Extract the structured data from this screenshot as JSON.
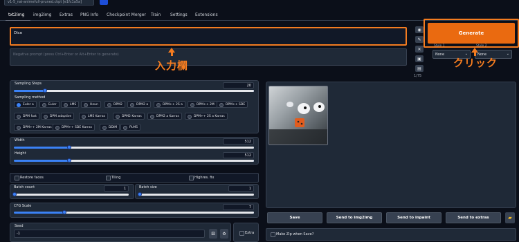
{
  "top": {
    "model_text": "v1-5_nai-animefull-pruned.ckpt [e1fc1a5a]"
  },
  "tabs": [
    "txt2img",
    "img2img",
    "Extras",
    "PNG Info",
    "Checkpoint Merger",
    "Train",
    "Settings",
    "Extensions"
  ],
  "prompt": {
    "value": "Dice",
    "neg_placeholder": "Negative prompt (press Ctrl+Enter or Alt+Enter to generate)"
  },
  "token_count": "1/75",
  "generate_label": "Generate",
  "styles": {
    "label1": "Style 1",
    "label2": "Style 2",
    "val1": "None",
    "val2": "None"
  },
  "annotations": {
    "input": "入力欄",
    "click": "クリック"
  },
  "sampling": {
    "steps_label": "Sampling Steps",
    "steps": "20",
    "steps_level": 0.13,
    "method_label": "Sampling method",
    "methods": [
      "Euler a",
      "Euler",
      "LMS",
      "Heun",
      "DPM2",
      "DPM2 a",
      "DPM++ 2S a",
      "DPM++ 2M",
      "DPM++ SDE",
      "DPM fast",
      "DPM adaptive",
      "LMS Karras",
      "DPM2 Karras",
      "DPM2 a Karras",
      "DPM++ 2S a Karras",
      "DPM++ 2M Karras",
      "DPM++ SDE Karras",
      "DDIM",
      "PLMS"
    ],
    "selected": "Euler a"
  },
  "size": {
    "width_label": "Width",
    "width": "512",
    "width_level": 0.23,
    "height_label": "Height",
    "height": "512",
    "height_level": 0.23
  },
  "checks": {
    "restore": "Restore faces",
    "tiling": "Tiling",
    "hires": "Highres. fix"
  },
  "batch": {
    "count_label": "Batch count",
    "count": "1",
    "size_label": "Batch size",
    "size": "1"
  },
  "cfg": {
    "label": "CFG Scale",
    "value": "7",
    "level": 0.21
  },
  "seed": {
    "label": "Seed",
    "value": "-1",
    "extra": "Extra"
  },
  "actions": [
    "Save",
    "Send to img2img",
    "Send to inpaint",
    "Send to extras"
  ],
  "zip_label": "Make Zip when Save?"
}
